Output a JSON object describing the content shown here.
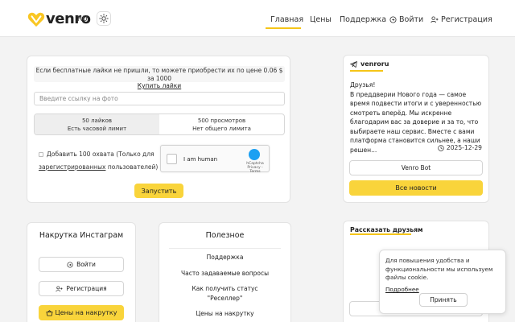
{
  "header": {
    "logo_text": "venro",
    "lang": "RU",
    "nav": {
      "prices_main": "Главная",
      "prices": "Цены",
      "support": "Поддержка",
      "login": "Войти",
      "register": "Регистрация"
    }
  },
  "order": {
    "info_text": "Если бесплатные лайки не пришли, то можете приобрести их по цене 0.06 $ за 1000",
    "info_link": "Купить лайки",
    "url_placeholder": "Введите ссылку на фото",
    "options": [
      {
        "title": "50 лайков",
        "subtitle": "Есть часовой лимит"
      },
      {
        "title": "500 просмотров",
        "subtitle": "Нет общего лимита"
      }
    ],
    "checkbox_text_1": "Добавить 100 охвата (Только для",
    "checkbox_link": "зарегистрированных",
    "checkbox_text_2": "пользователей)",
    "captcha_label": "I am human",
    "captcha_brand": "hCaptcha",
    "captcha_links": "Privacy - Terms",
    "start_button": "Запустить"
  },
  "telegram": {
    "channel": "venroru",
    "message": "Друзья!\nВ преддверии Нового года — самое время подвести итоги и с уверенностью смотреть вперёд. Мы искренне благодарим вас за доверие и за то, что выбираете наш сервис. Вместе с вами платформа становится сильнее, а наши решен...",
    "date": "2025-12-29",
    "bot_button": "Venro Bot",
    "news_button": "Все новости"
  },
  "insta": {
    "title": "Накрутка Инстаграм",
    "login_button": "Войти",
    "register_button": "Регистрация",
    "prices_button": "Цены на накрутку"
  },
  "useful": {
    "title": "Полезное",
    "links": [
      "Поддержка",
      "Часто задаваемые вопросы",
      "Как получить статус \"Реселлер\"",
      "Цены на накрутку"
    ]
  },
  "share": {
    "title": "Рассказать друзьям"
  },
  "cookie": {
    "text": "Для повышения удобства и функциональности мы используем файлы cookie.",
    "more": "Подробнее",
    "accept": "Принять"
  },
  "colors": {
    "accent": "#f9d43b",
    "underline": "#f5c518",
    "captcha_blue": "#1ca0f2"
  }
}
